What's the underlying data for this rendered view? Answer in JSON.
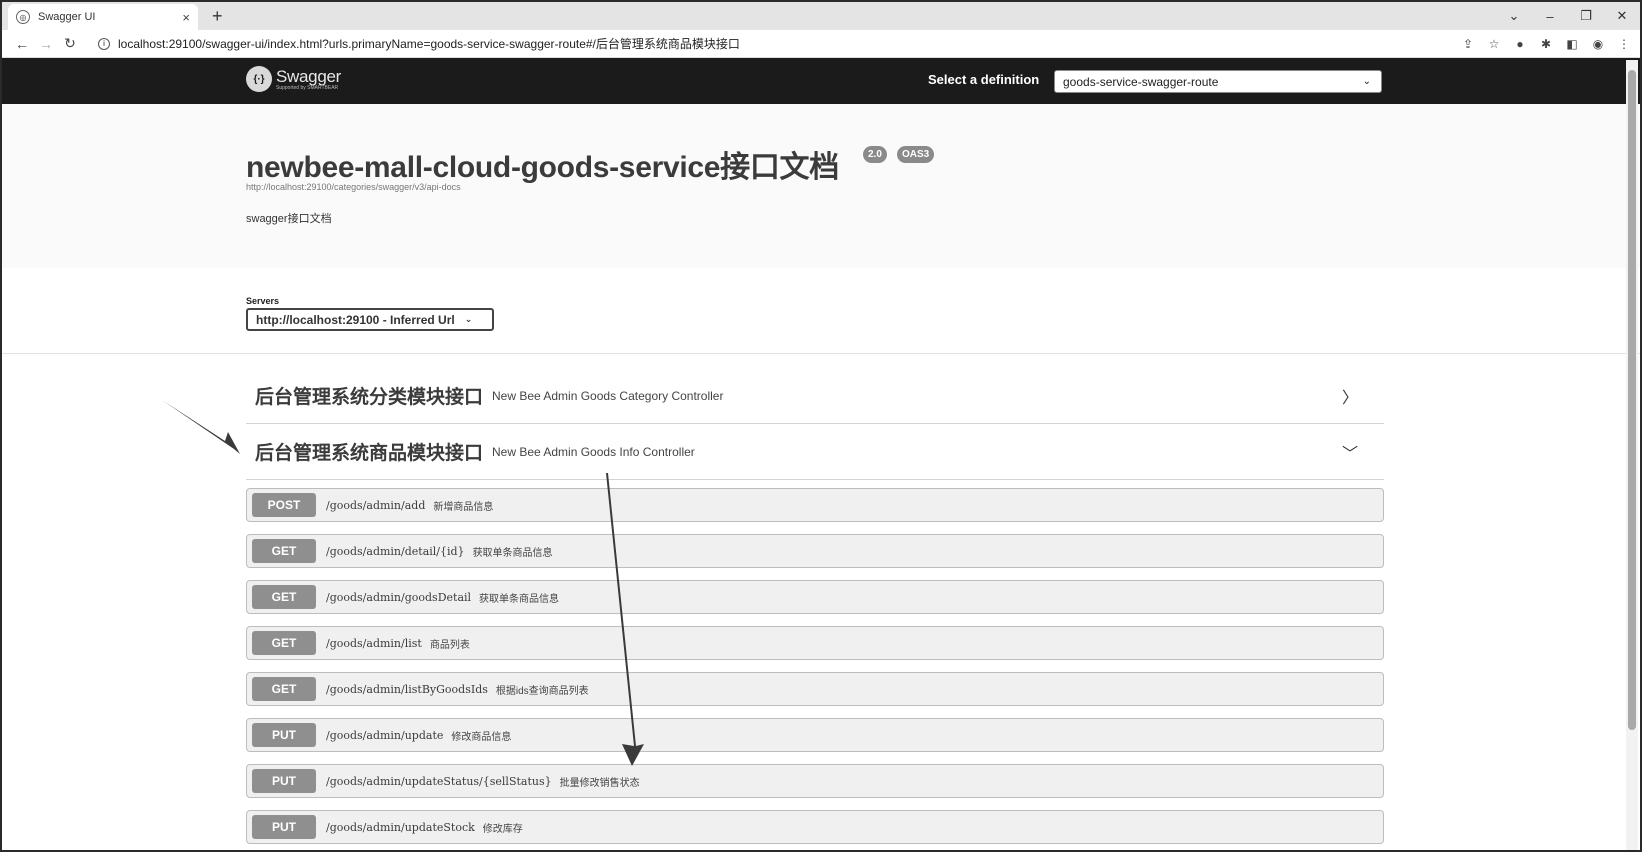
{
  "browser": {
    "tab_title": "Swagger UI",
    "tab_close": "×",
    "new_tab": "+",
    "address": "localhost:29100/swagger-ui/index.html?urls.primaryName=goods-service-swagger-route#/后台管理系统商品模块接口"
  },
  "topbar": {
    "logo_text": "Swagger",
    "logo_sub": "Supported by SMARTBEAR",
    "select_label": "Select a definition",
    "selected_definition": "goods-service-swagger-route"
  },
  "info": {
    "title": "newbee-mall-cloud-goods-service接口文档",
    "version_badge": "2.0",
    "oas_badge": "OAS3",
    "url": "http://localhost:29100/categories/swagger/v3/api-docs",
    "description": "swagger接口文档"
  },
  "servers": {
    "label": "Servers",
    "selected": "http://localhost:29100 - Inferred Url"
  },
  "tags": [
    {
      "name": "后台管理系统分类模块接口",
      "description": "New Bee Admin Goods Category Controller",
      "expanded": false
    },
    {
      "name": "后台管理系统商品模块接口",
      "description": "New Bee Admin Goods Info Controller",
      "expanded": true
    }
  ],
  "operations": [
    {
      "method": "POST",
      "path": "/goods/admin/add",
      "summary": "新增商品信息"
    },
    {
      "method": "GET",
      "path": "/goods/admin/detail/{id}",
      "summary": "获取单条商品信息"
    },
    {
      "method": "GET",
      "path": "/goods/admin/goodsDetail",
      "summary": "获取单条商品信息"
    },
    {
      "method": "GET",
      "path": "/goods/admin/list",
      "summary": "商品列表"
    },
    {
      "method": "GET",
      "path": "/goods/admin/listByGoodsIds",
      "summary": "根据ids查询商品列表"
    },
    {
      "method": "PUT",
      "path": "/goods/admin/update",
      "summary": "修改商品信息"
    },
    {
      "method": "PUT",
      "path": "/goods/admin/updateStatus/{sellStatus}",
      "summary": "批量修改销售状态"
    },
    {
      "method": "PUT",
      "path": "/goods/admin/updateStock",
      "summary": "修改库存"
    }
  ]
}
